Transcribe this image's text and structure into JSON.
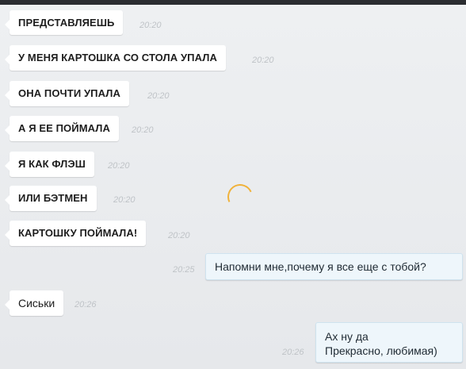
{
  "messages": [
    {
      "text": "ПРЕДСТАВЛЯЕШЬ",
      "time": "20:20",
      "side": "in"
    },
    {
      "text": "У МЕНЯ КАРТОШКА СО СТОЛА УПАЛА",
      "time": "20:20",
      "side": "in"
    },
    {
      "text": "ОНА ПОЧТИ УПАЛА",
      "time": "20:20",
      "side": "in"
    },
    {
      "text": "А Я ЕЕ ПОЙМАЛА",
      "time": "20:20",
      "side": "in"
    },
    {
      "text": "Я КАК ФЛЭШ",
      "time": "20:20",
      "side": "in"
    },
    {
      "text": "ИЛИ БЭТМЕН",
      "time": "20:20",
      "side": "in"
    },
    {
      "text": "КАРТОШКУ ПОЙМАЛА!",
      "time": "20:20",
      "side": "in"
    },
    {
      "text": "Напомни мне,почему я все еще с тобой?",
      "time": "20:25",
      "side": "out"
    },
    {
      "text": "Сиськи",
      "time": "20:26",
      "side": "in"
    },
    {
      "text_line1": "Ах ну да",
      "text_line2": "Прекрасно, любимая)",
      "time": "20:26",
      "side": "out"
    }
  ],
  "colors": {
    "background": "#e9ebee",
    "incoming_bubble": "#ffffff",
    "outgoing_bubble": "#eef6fb",
    "spinner": "#f0b23a"
  },
  "icons": {
    "loading": "loading-spinner-icon"
  }
}
